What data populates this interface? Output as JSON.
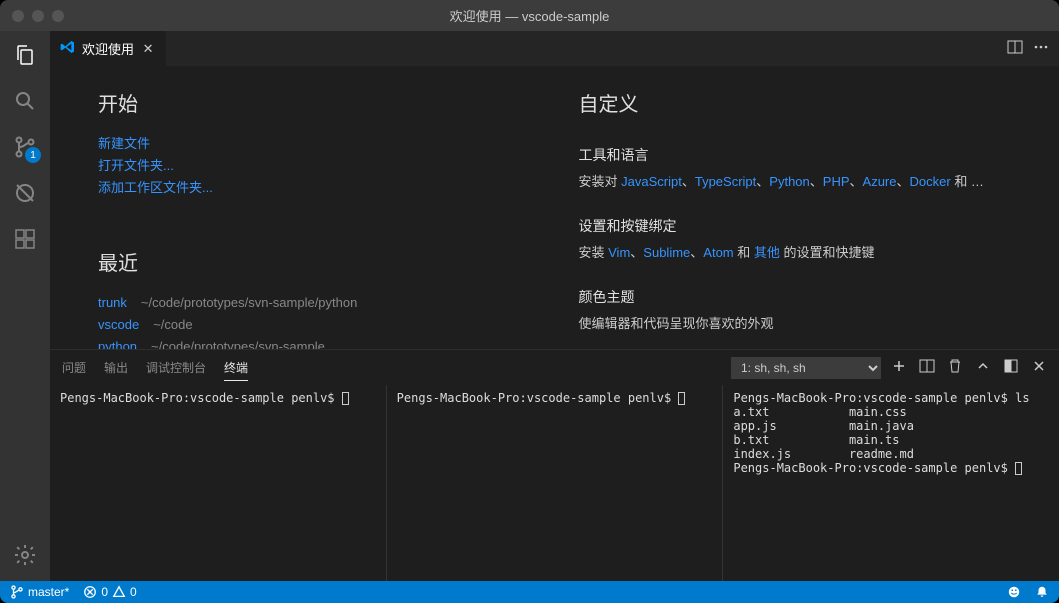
{
  "titlebar": {
    "title": "欢迎使用 — vscode-sample"
  },
  "activitybar": {
    "scm_badge": "1"
  },
  "tab": {
    "label": "欢迎使用"
  },
  "welcome": {
    "start_heading": "开始",
    "start_links": {
      "a": "新建文件",
      "b": "打开文件夹...",
      "c": "添加工作区文件夹..."
    },
    "recent_heading": "最近",
    "recent": [
      {
        "name": "trunk",
        "path": "~/code/prototypes/svn-sample/python"
      },
      {
        "name": "vscode",
        "path": "~/code"
      },
      {
        "name": "python",
        "path": "~/code/prototypes/svn-sample"
      }
    ],
    "customize_heading": "自定义",
    "tools": {
      "heading": "工具和语言",
      "prefix": "安装对 ",
      "links": {
        "js": "JavaScript",
        "ts": "TypeScript",
        "py": "Python",
        "php": "PHP",
        "az": "Azure",
        "dk": "Docker"
      },
      "suffix": " 和 …"
    },
    "settings": {
      "heading": "设置和按键绑定",
      "prefix": "安装 ",
      "links": {
        "vim": "Vim",
        "sublime": "Sublime",
        "atom": "Atom",
        "others": "其他"
      },
      "mid": " 和 ",
      "suffix": " 的设置和快捷键"
    },
    "theme": {
      "heading": "颜色主题",
      "text": "使编辑器和代码呈现你喜欢的外观"
    }
  },
  "panel": {
    "tabs": {
      "problems": "问题",
      "output": "输出",
      "debug": "调试控制台",
      "terminal": "终端"
    },
    "selector": "1: sh, sh, sh",
    "term1_prompt": "Pengs-MacBook-Pro:vscode-sample penlv$ ",
    "term2_prompt": "Pengs-MacBook-Pro:vscode-sample penlv$ ",
    "term3_lines": [
      "Pengs-MacBook-Pro:vscode-sample penlv$ ls",
      "a.txt           main.css",
      "app.js          main.java",
      "b.txt           main.ts",
      "index.js        readme.md",
      "Pengs-MacBook-Pro:vscode-sample penlv$ "
    ]
  },
  "statusbar": {
    "branch": "master*",
    "errors": "0",
    "warnings": "0"
  }
}
